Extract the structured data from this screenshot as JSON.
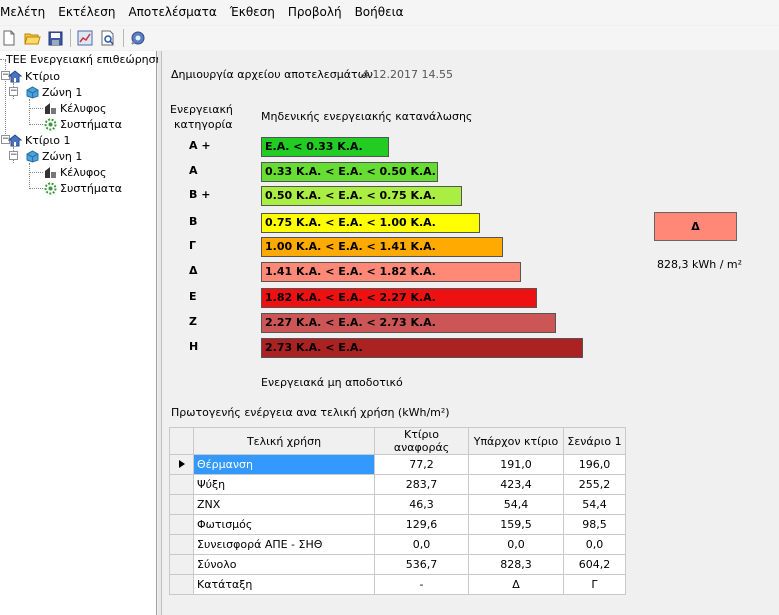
{
  "menu": [
    "Μελέτη",
    "Εκτέλεση",
    "Αποτελέσματα",
    "Έκθεση",
    "Προβολή",
    "Βοήθεια"
  ],
  "toolbar_icons": [
    "new-icon",
    "open-icon",
    "save-icon",
    "chart-icon",
    "preview-icon",
    "settings-icon"
  ],
  "tree": {
    "root": "ΤΕΕ Ενεργειακή επιθεώρηση",
    "buildings": [
      {
        "label": "Κτίριο",
        "zone": "Ζώνη 1",
        "shell": "Κέλυφος",
        "systems": "Συστήματα"
      },
      {
        "label": "Κτίριο 1",
        "zone": "Ζώνη 1",
        "shell": "Κέλυφος",
        "systems": "Συστήματα"
      }
    ]
  },
  "results": {
    "created_label": "Δημιουργία αρχείου αποτελεσμάτων",
    "created_date": "4.12.2017 14.55",
    "category_header_line1": "Ενεργειακή",
    "category_header_line2": "κατηγορία",
    "nzeb_header": "Μηδενικής ενεργειακής κατανάλωσης",
    "inefficient_label": "Ενεργειακά μη αποδοτικό",
    "categories": [
      {
        "letter": "Α +",
        "range": "Ε.Α. < 0.33 Κ.Α.",
        "color": "#22cc22",
        "width": 128
      },
      {
        "letter": "Α",
        "range": "0.33 Κ.Α. < Ε.Α. < 0.50 Κ.Α.",
        "color": "#66dd33",
        "width": 177
      },
      {
        "letter": "Β +",
        "range": "0.50 Κ.Α. < Ε.Α. < 0.75 Κ.Α.",
        "color": "#aaee44",
        "width": 201
      },
      {
        "letter": "Β",
        "range": "0.75 Κ.Α. < Ε.Α. < 1.00 Κ.Α.",
        "color": "#ffff00",
        "width": 219
      },
      {
        "letter": "Γ",
        "range": "1.00 Κ.Α. < Ε.Α. < 1.41 Κ.Α.",
        "color": "#ffaa00",
        "width": 242
      },
      {
        "letter": "Δ",
        "range": "1.41 Κ.Α. < Ε.Α. < 1.82 Κ.Α.",
        "color": "#ff8877",
        "width": 260
      },
      {
        "letter": "Ε",
        "range": "1.82 Κ.Α. < Ε.Α. < 2.27 Κ.Α.",
        "color": "#ee1111",
        "width": 276
      },
      {
        "letter": "Ζ",
        "range": "2.27 Κ.Α. < Ε.Α. < 2.73 Κ.Α.",
        "color": "#cc5555",
        "width": 295
      },
      {
        "letter": "Η",
        "range": "2.73 Κ.Α. < Ε.Α.",
        "color": "#aa2222",
        "width": 322
      }
    ],
    "result_category": "Δ",
    "result_color": "#ff8877",
    "result_value": "828,3 kWh / m²"
  },
  "table": {
    "caption": "Πρωτογενής ενέργεια ανα τελική χρήση (kWh/m²)",
    "columns": [
      "Τελική χρήση",
      "Κτίριο αναφοράς",
      "Υπάρχον κτίριο",
      "Σενάριο 1"
    ],
    "rows": [
      [
        "Θέρμανση",
        "77,2",
        "191,0",
        "196,0"
      ],
      [
        "Ψύξη",
        "283,7",
        "423,4",
        "255,2"
      ],
      [
        "ZNX",
        "46,3",
        "54,4",
        "54,4"
      ],
      [
        "Φωτισμός",
        "129,6",
        "159,5",
        "98,5"
      ],
      [
        "Συνεισφορά ΑΠΕ - ΣΗΘ",
        "0,0",
        "0,0",
        "0,0"
      ],
      [
        "Σύνολο",
        "536,7",
        "828,3",
        "604,2"
      ],
      [
        "Κατάταξη",
        "-",
        "Δ",
        "Γ"
      ]
    ]
  }
}
